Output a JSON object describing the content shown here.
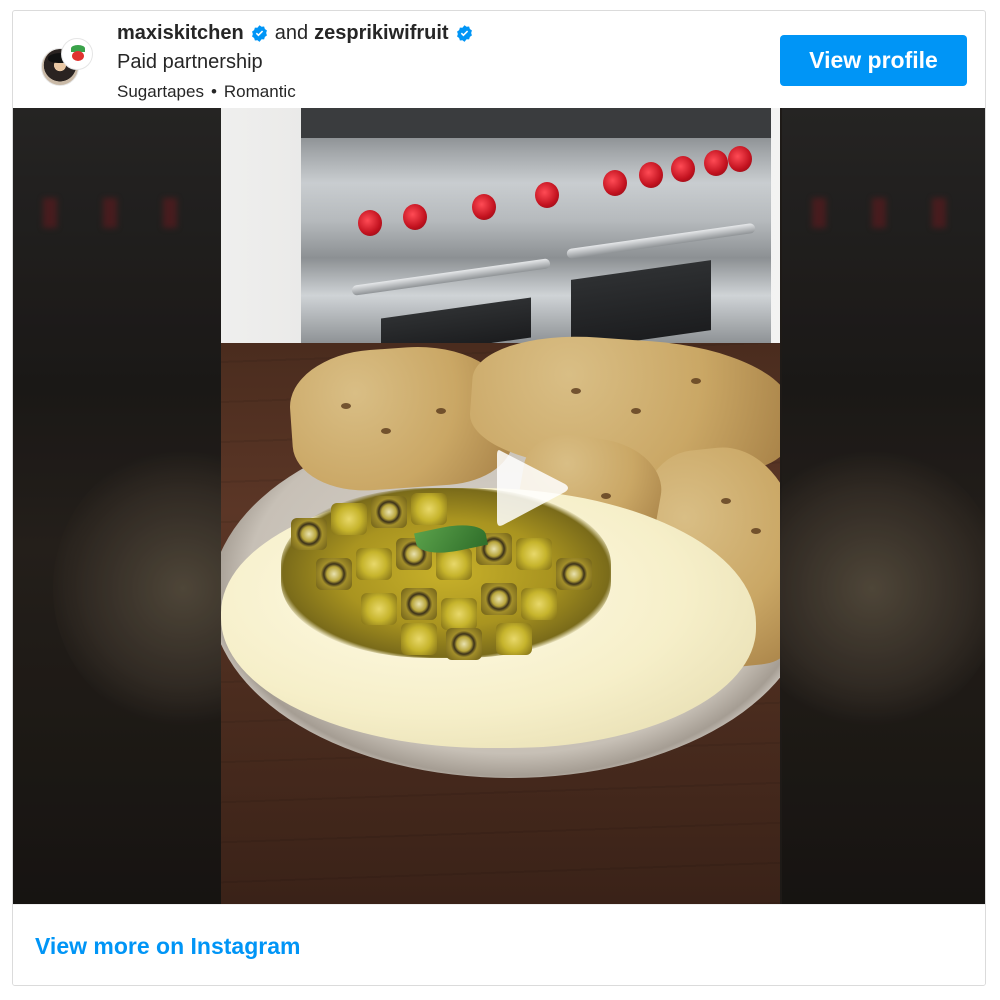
{
  "post": {
    "author": "maxiskitchen",
    "conjunction": "and",
    "partner": "zesprikiwifruit",
    "subtitle": "Paid partnership",
    "audio_artist": "Sugartapes",
    "audio_separator": "•",
    "audio_title": "Romantic",
    "view_profile_label": "View profile",
    "view_more_label": "View more on Instagram"
  },
  "icons": {
    "verified": "verified-badge-icon",
    "play": "play-icon"
  },
  "colors": {
    "accent": "#0095f6",
    "text": "#262626",
    "border": "#dbdbdb"
  }
}
